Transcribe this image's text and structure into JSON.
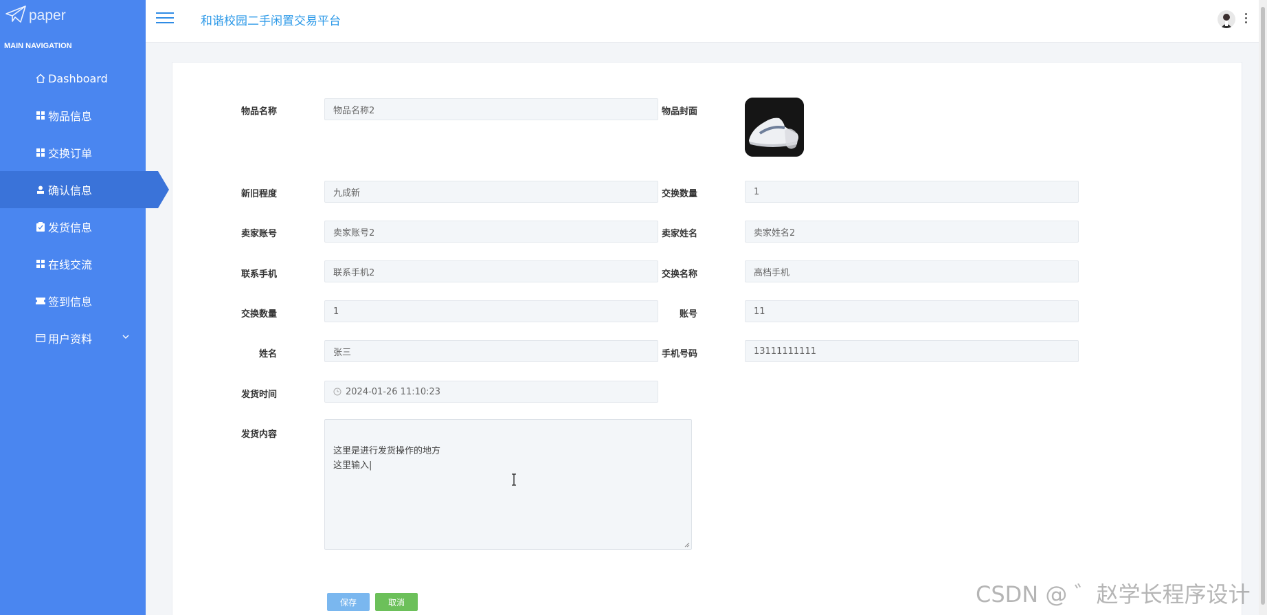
{
  "logo": {
    "text": "paper",
    "icon": "paper-plane-icon"
  },
  "sidebar": {
    "header": "MAIN NAVIGATION",
    "items": [
      {
        "label": "Dashboard",
        "icon": "home-icon"
      },
      {
        "label": "物品信息",
        "icon": "grid-icon"
      },
      {
        "label": "交换订单",
        "icon": "grid-icon"
      },
      {
        "label": "确认信息",
        "icon": "user-icon",
        "active": true
      },
      {
        "label": "发货信息",
        "icon": "clipboard-icon"
      },
      {
        "label": "在线交流",
        "icon": "grid-icon"
      },
      {
        "label": "签到信息",
        "icon": "ticket-icon"
      },
      {
        "label": "用户资料",
        "icon": "card-icon",
        "expandable": true
      }
    ]
  },
  "header": {
    "title": "和谐校园二手闲置交易平台"
  },
  "form": {
    "item_name_label": "物品名称",
    "item_name": "物品名称2",
    "cover_label": "物品封面",
    "condition_label": "新旧程度",
    "condition": "九成新",
    "exchange_qty_label": "交换数量",
    "exchange_qty": "1",
    "seller_account_label": "卖家账号",
    "seller_account": "卖家账号2",
    "seller_name_label": "卖家姓名",
    "seller_name": "卖家姓名2",
    "contact_phone_label": "联系手机",
    "contact_phone": "联系手机2",
    "exchange_name_label": "交换名称",
    "exchange_name": "高档手机",
    "exchange_qty2_label": "交换数量",
    "exchange_qty2": "1",
    "account_label": "账号",
    "account": "11",
    "name_label": "姓名",
    "name": "张三",
    "mobile_label": "手机号码",
    "mobile": "13111111111",
    "ship_time_label": "发货时间",
    "ship_time": "2024-01-26 11:10:23",
    "ship_content_label": "发货内容",
    "ship_content": "这里是进行发货操作的地方\n这里输入|"
  },
  "buttons": {
    "save": "保存",
    "cancel": "取消"
  },
  "watermark": "CSDN @ ゛赵学长程序设计",
  "colors": {
    "sidebar": "#4a86f0",
    "active": "#3a73d9",
    "title": "#2e9ae8",
    "save": "#7ab7ef",
    "cancel": "#6cc05a"
  }
}
